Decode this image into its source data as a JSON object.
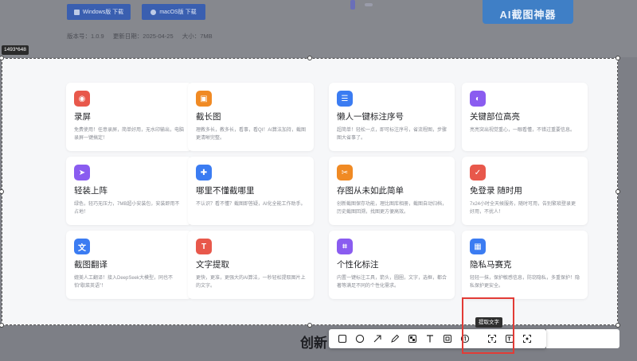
{
  "background": {
    "windows_button": "Windows版 下载",
    "mac_button": "macOS版 下载",
    "version": "版本号：1.0.9",
    "updated": "更新日期：2025-04-25",
    "size": "大小：7MB",
    "brand_banner": "AI截图神器",
    "bottom_title": "创新"
  },
  "selection": {
    "size_label": "1493*648"
  },
  "cards": [
    {
      "title": "录屏",
      "desc": "免费使用！任意录屏，简单好用，无水印输出，电脑录屏一键搞定！",
      "icon": "record-icon",
      "color": "#e8584b",
      "glyph": "◉"
    },
    {
      "title": "截长图",
      "desc": "理教多长，教多长，看事，看QI！AI算法加持，截图更清晰完整。",
      "icon": "image-icon",
      "color": "#f08a24",
      "glyph": "▣"
    },
    {
      "title": "懒人一键标注序号",
      "desc": "超简单！轻松一点，即可标注序号，省流程图，步骤图大省事了。",
      "icon": "list-icon",
      "color": "#3b7cf2",
      "glyph": "☰"
    },
    {
      "title": "关键部位高亮",
      "desc": "亮亮突出视觉重心，一眼看懂，不错过重要信息。",
      "icon": "bulb-icon",
      "color": "#8a5cf0",
      "glyph": "◐"
    },
    {
      "title": "轻装上阵",
      "desc": "绿色，轻巧无压力，7MB超小安装包，安装即用不占地！",
      "icon": "send-icon",
      "color": "#8a5cf0",
      "glyph": "➤"
    },
    {
      "title": "哪里不懂截哪里",
      "desc": "不认识？看不懂？截图即答疑，AI化全能工作助手。",
      "icon": "doc-plus-icon",
      "color": "#3b7cf2",
      "glyph": "✚"
    },
    {
      "title": "存图从未如此简单",
      "desc": "创新截图保存功能，理比图库相册，截图自动归档，历史截图回溯，找图更方便高效。",
      "icon": "scissors-icon",
      "color": "#f08a24",
      "glyph": "✂"
    },
    {
      "title": "免登录 随时用",
      "desc": "7x24小时全天候服务，随时可用，告别繁琐登录更好用，不扰人！",
      "icon": "check-icon",
      "color": "#e8584b",
      "glyph": "✓"
    },
    {
      "title": "截图翻译",
      "desc": "媲美人工翻译！接入DeepSeek大模型，同也不怕“歇菜英语”！",
      "icon": "translate-icon",
      "color": "#3b7cf2",
      "glyph": "文"
    },
    {
      "title": "文字提取",
      "desc": "更快，更准，更强大的AI算法，一秒轻松提取图片上的文字。",
      "icon": "text-extract-icon",
      "color": "#e8584b",
      "glyph": "T"
    },
    {
      "title": "个性化标注",
      "desc": "内置一键标注工具，箭头，圆圈，文字，选框，都合著等满足不同的个性化需求。",
      "icon": "frame-icon",
      "color": "#8a5cf0",
      "glyph": "⌗"
    },
    {
      "title": "隐私马赛克",
      "desc": "轻轻一抹，保护敏感信息，防窃隐私，多重保护！隐私保护更安全。",
      "icon": "mosaic-icon",
      "color": "#3b7cf2",
      "glyph": "▦"
    }
  ],
  "toolbar": {
    "tooltip": "提取文字",
    "tools": [
      "rectangle-tool",
      "ellipse-tool",
      "arrow-tool",
      "pen-tool",
      "mosaic-tool",
      "text-tool",
      "pin-tool",
      "number-tool",
      "text-extract-tool",
      "translate-tool",
      "ocr-tool"
    ]
  }
}
